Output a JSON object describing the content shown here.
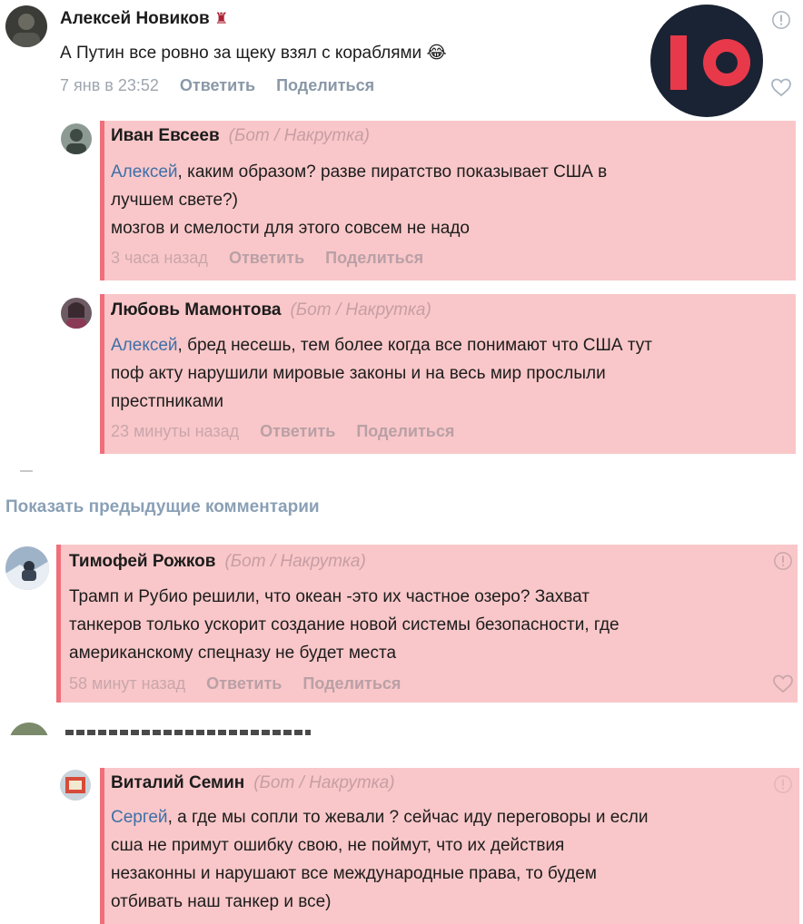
{
  "channel_logo": {
    "text": "10",
    "bg": "#1a2333",
    "accent": "#e8394a"
  },
  "top_comment": {
    "author": "Алексей Новиков",
    "text": "А Путин все ровно за щеку взял с кораблями",
    "emoji": "😂",
    "time": "7 янв в 23:52",
    "reply_label": "Ответить",
    "share_label": "Поделиться"
  },
  "replies": [
    {
      "author": "Иван Евсеев",
      "tag": "(Бот / Накрутка)",
      "reply_to": "Алексей",
      "line1_rest": ", каким образом? разве пиратство показывает США в",
      "line2": "лучшем свете?)",
      "line3": "мозгов и смелости для этого совсем не надо",
      "time": "3 часа назад",
      "reply_label": "Ответить",
      "share_label": "Поделиться"
    },
    {
      "author": "Любовь Мамонтова",
      "tag": "(Бот / Накрутка)",
      "reply_to": "Алексей",
      "line1_rest": ", бред несешь, тем более когда все понимают что США тут",
      "line2": "поф акту нарушили мировые законы и на весь мир прослыли",
      "line3": "престпниками",
      "time": "23 минуты назад",
      "reply_label": "Ответить",
      "share_label": "Поделиться"
    }
  ],
  "show_previous": "Показать предыдущие комментарии",
  "comment2": {
    "author": "Тимофей Рожков",
    "tag": "(Бот / Накрутка)",
    "line1": "Трамп и Рубио решили, что океан -это их частное озеро? Захват",
    "line2": "танкеров только ускорит создание новой системы безопасности, где",
    "line3": "американскому спецназу не будет места",
    "time": "58 минут назад",
    "reply_label": "Ответить",
    "share_label": "Поделиться"
  },
  "comment3": {
    "author": "Виталий Семин",
    "tag": "(Бот / Накрутка)",
    "reply_to": "Сергей",
    "line1_rest": ", а где мы сопли то жевали ? сейчас иду переговоры и если",
    "line2": "сша не примут ошибку свою, не поймут, что их действия",
    "line3": "незаконны и нарушают все международные права, то будем",
    "line4": "отбивать наш танкер и все)"
  },
  "colors": {
    "highlight": "#f9c7c9",
    "highlight_border": "#ef6f7a",
    "link": "#3d6fa8"
  }
}
